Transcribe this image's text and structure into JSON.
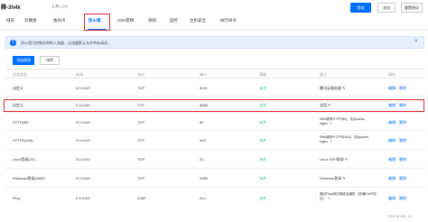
{
  "header": {
    "title": "腾-3h4k",
    "region": "上海 | (公)",
    "buttons": {
      "login": "登录",
      "shutdown": "关机",
      "reboot": "重置密码"
    }
  },
  "tabs": [
    {
      "label": "域名"
    },
    {
      "label": "云硬盘"
    },
    {
      "label": "备份点"
    },
    {
      "label": "防火墙",
      "active": true
    },
    {
      "label": "SSH密钥"
    },
    {
      "label": "快照"
    },
    {
      "label": "监控"
    },
    {
      "label": "主机安全"
    },
    {
      "label": "执行命令"
    }
  ],
  "notice": {
    "text": "防火墙可控制实例的入流量，出流量默认允许所有请求。",
    "close": "×"
  },
  "toolbar": {
    "add_rule": "添加规则",
    "sort": "排序"
  },
  "table": {
    "columns": [
      "应用类型",
      "来源",
      "协议",
      "端口",
      "策略",
      "备注",
      "操作"
    ],
    "rows": [
      {
        "app": "自定义",
        "source": "0.0.0.0/0",
        "protocol": "TCP",
        "port": "3021",
        "policy": "允许",
        "note": "腾讯云服务器",
        "actions": [
          "编辑",
          "删除"
        ]
      },
      {
        "app": "自定义",
        "source": "0.0.0.0/0",
        "protocol": "TCP",
        "port": "8888",
        "policy": "允许",
        "note": "宝塔",
        "actions": [
          "编辑",
          "删除"
        ]
      },
      {
        "app": "HTTP(80)",
        "source": "0.0.0.0/0",
        "protocol": "TCP",
        "port": "80",
        "policy": "允许",
        "note": "Web服务HTTP(80)，如Apache、Nginx",
        "actions": [
          "编辑",
          "删除"
        ]
      },
      {
        "app": "HTTPS(443)",
        "source": "0.0.0.0/0",
        "protocol": "TCP",
        "port": "443",
        "policy": "允许",
        "note": "Web服务HTTPS(443)，如Apache、Nginx",
        "actions": [
          "编辑",
          "删除"
        ]
      },
      {
        "app": "Linux登录(22)",
        "source": "0.0.0.0/0",
        "protocol": "TCP",
        "port": "22",
        "policy": "允许",
        "note": "Linux SSH登录",
        "actions": [
          "编辑",
          "删除"
        ]
      },
      {
        "app": "Windows登录(3389)",
        "source": "0.0.0.0/0",
        "protocol": "TCP",
        "port": "3389",
        "policy": "允许",
        "note": "Windows登录",
        "actions": [
          "编辑",
          "删除"
        ]
      },
      {
        "app": "Ping",
        "source": "0.0.0.0/0",
        "protocol": "ICMP",
        "port": "ALL",
        "policy": "允许",
        "note": "通过Ping测试网络连通性（放通ICMP协议）",
        "actions": [
          "编辑",
          "删除"
        ]
      }
    ]
  },
  "watermark": "CSDN @YHN_I23"
}
